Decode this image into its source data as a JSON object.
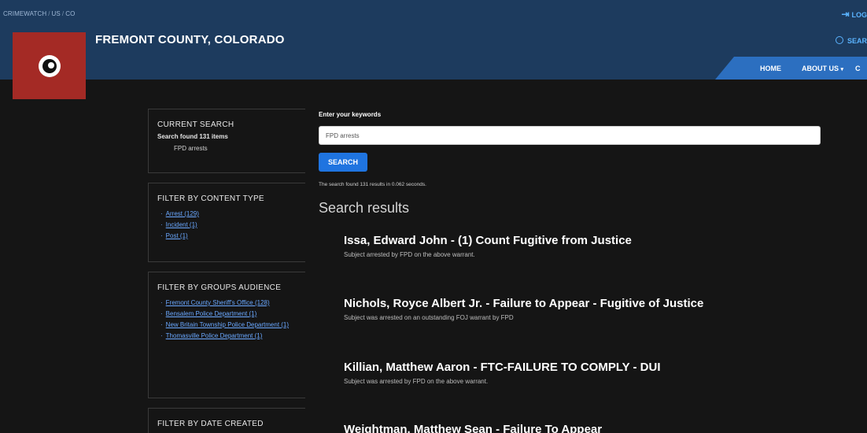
{
  "breadcrumb": {
    "items": [
      "CRIMEWATCH",
      "US",
      "CO"
    ],
    "separator": "/"
  },
  "header": {
    "login_label": "LOG",
    "search_label": "SEAR",
    "site_title": "FREMONT COUNTY, COLORADO",
    "nav": {
      "home": "HOME",
      "about": "ABOUT US",
      "about_caret": "▾",
      "next": "C"
    }
  },
  "sidebar": {
    "current_search": {
      "title": "CURRENT SEARCH",
      "found": "Search found 131 items",
      "term": "FPD arrests"
    },
    "content_type": {
      "title": "FILTER BY CONTENT TYPE",
      "items": [
        {
          "label": "Arrest (129)"
        },
        {
          "label": "Incident (1)"
        },
        {
          "label": "Post (1)"
        }
      ]
    },
    "groups": {
      "title": "FILTER BY GROUPS AUDIENCE",
      "items": [
        {
          "label": "Fremont County Sheriff's Office (128)"
        },
        {
          "label": "Bensalem Police Department (1)"
        },
        {
          "label": "New Britain Township Police Department (1)"
        },
        {
          "label": "Thomasville Police Department (1)"
        }
      ]
    },
    "date_created": {
      "title": "FILTER BY DATE CREATED"
    }
  },
  "search": {
    "label": "Enter your keywords",
    "value": "FPD arrests",
    "button": "SEARCH",
    "found_time": "The search found 131 results in 0.062 seconds.",
    "results_heading": "Search results"
  },
  "results": [
    {
      "title": "Issa, Edward John - (1) Count Fugitive from Justice",
      "snippet": "Subject arrested by FPD on the above warrant."
    },
    {
      "title": "Nichols, Royce Albert Jr. - Failure to Appear - Fugitive of Justice",
      "snippet": "Subject was arrested on an outstanding FOJ warrant by FPD"
    },
    {
      "title": "Killian, Matthew Aaron - FTC-FAILURE TO COMPLY - DUI",
      "snippet": "Subject was arrested by FPD on the above warrant."
    },
    {
      "title": "Weightman, Matthew Sean - Failure To Appear",
      "snippet": ""
    }
  ],
  "colors": {
    "header_bg": "#1d3b5e",
    "nav_bg": "#2c6fc0",
    "logo_bg": "#a42a25",
    "link": "#6aa8ff",
    "button": "#1f74e0",
    "page_bg": "#151515"
  }
}
